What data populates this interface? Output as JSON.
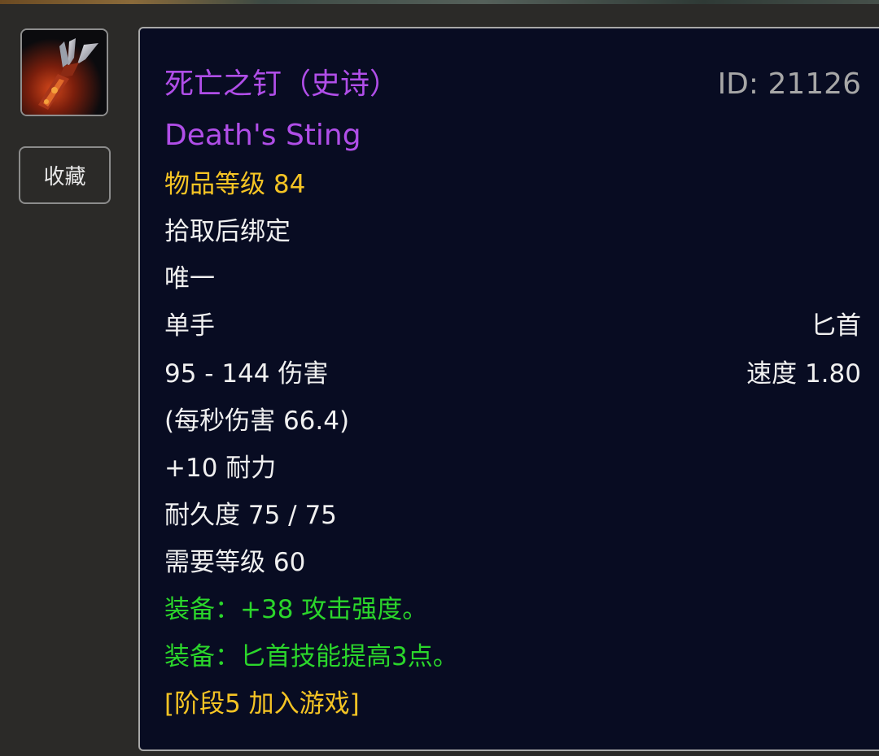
{
  "item": {
    "icon": "dagger-icon",
    "name_cn": "死亡之钉（史诗）",
    "name_en": "Death's Sting",
    "id_text": "ID: 21126",
    "item_level": "物品等级 84",
    "bind": "拾取后绑定",
    "unique": "唯一",
    "slot": "单手",
    "type": "匕首",
    "damage": "95 - 144 伤害",
    "speed": "速度 1.80",
    "dps": "(每秒伤害 66.4)",
    "stamina": "+10 耐力",
    "durability": "耐久度 75 / 75",
    "required_level": "需要等级 60",
    "equip_1": "装备：+38 攻击强度。",
    "equip_2": "装备：匕首技能提高3点。",
    "phase": "[阶段5 加入游戏]"
  },
  "sidebar": {
    "favorite_label": "收藏"
  },
  "colors": {
    "epic": "#b04ee8",
    "gold": "#f5c424",
    "green": "#2bd62b",
    "white": "#f0f0f0",
    "id_gray": "#a7a7a7",
    "tooltip_bg": "#080c22"
  }
}
